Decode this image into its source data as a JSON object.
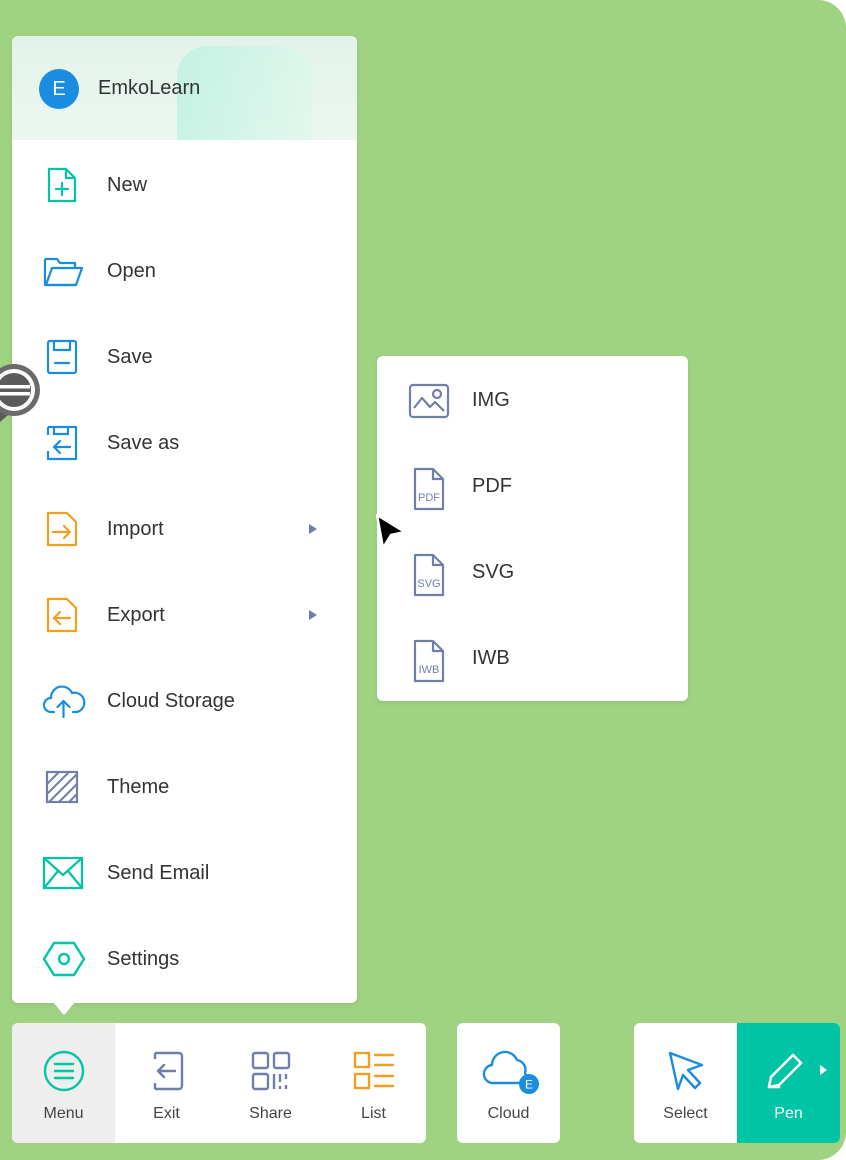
{
  "user": {
    "initial": "E",
    "name": "EmkoLearn"
  },
  "menu": {
    "items": [
      {
        "label": "New",
        "icon": "new-file-icon"
      },
      {
        "label": "Open",
        "icon": "folder-open-icon"
      },
      {
        "label": "Save",
        "icon": "save-icon"
      },
      {
        "label": "Save as",
        "icon": "save-as-icon"
      },
      {
        "label": "Import",
        "icon": "import-icon",
        "has_submenu": true
      },
      {
        "label": "Export",
        "icon": "export-icon",
        "has_submenu": true
      },
      {
        "label": "Cloud Storage",
        "icon": "cloud-upload-icon"
      },
      {
        "label": "Theme",
        "icon": "theme-icon"
      },
      {
        "label": "Send Email",
        "icon": "email-icon"
      },
      {
        "label": "Settings",
        "icon": "settings-icon"
      }
    ]
  },
  "submenu": {
    "items": [
      {
        "label": "IMG",
        "icon": "image-icon"
      },
      {
        "label": "PDF",
        "icon": "pdf-file-icon",
        "badge": "PDF"
      },
      {
        "label": "SVG",
        "icon": "svg-file-icon",
        "badge": "SVG"
      },
      {
        "label": "IWB",
        "icon": "iwb-file-icon",
        "badge": "IWB"
      }
    ]
  },
  "toolbar": {
    "menu_label": "Menu",
    "exit_label": "Exit",
    "share_label": "Share",
    "list_label": "List",
    "cloud_label": "Cloud",
    "cloud_badge": "E",
    "select_label": "Select",
    "pen_label": "Pen"
  },
  "colors": {
    "background": "#9fd381",
    "teal": "#00c4a4",
    "blue": "#1a8de0",
    "orange": "#f0a020",
    "slate": "#6f7fa8"
  }
}
